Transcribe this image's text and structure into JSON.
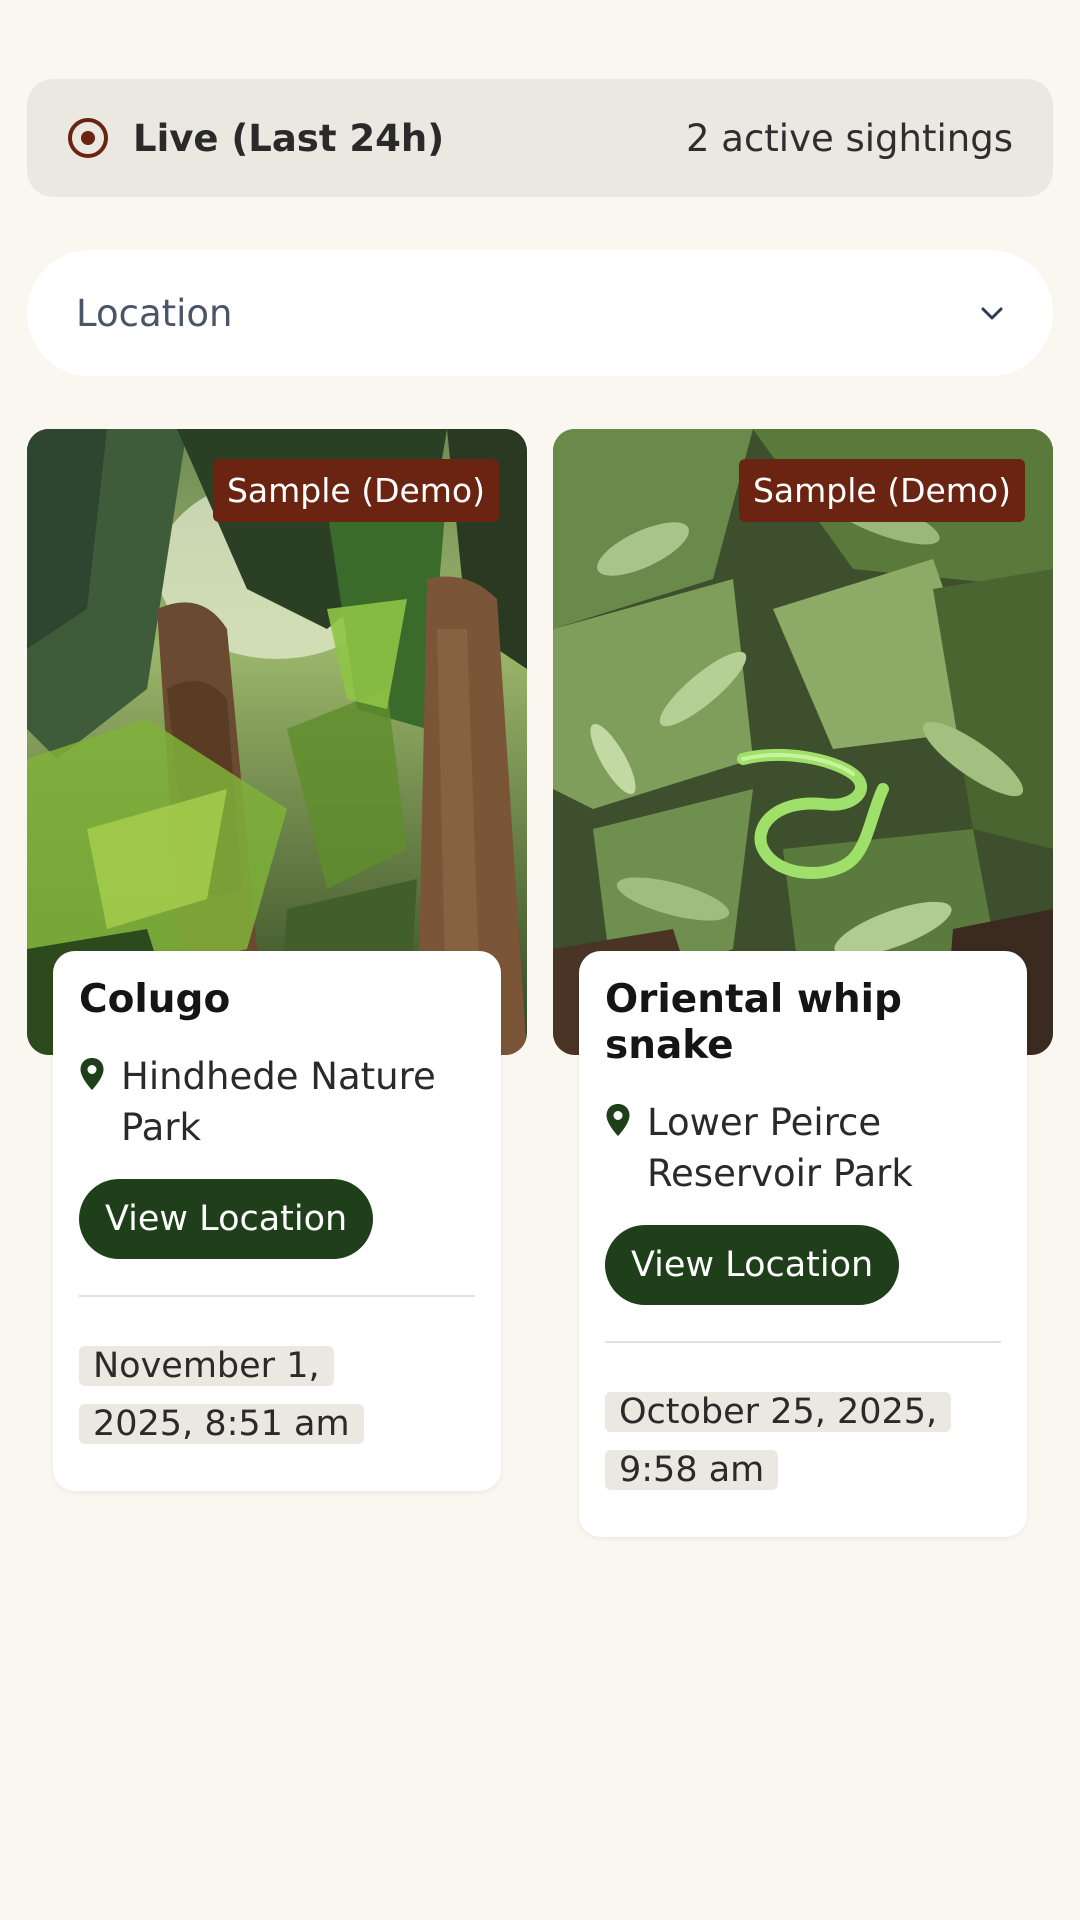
{
  "live": {
    "label": "Live (Last 24h)",
    "count": "2 active sightings",
    "icon": "target-icon",
    "accent": "#6b2412"
  },
  "filter": {
    "label": "Location",
    "icon": "chevron-down-icon"
  },
  "sightings": [
    {
      "badge": "Sample (Demo)",
      "species": "Colugo",
      "location": "Hindhede Nature Park",
      "button": "View Location",
      "time": "November 1, 2025, 8:51 am",
      "image": "forest-palm-trunk-photo"
    },
    {
      "badge": "Sample (Demo)",
      "species": "Oriental whip snake",
      "location": "Lower Peirce Reservoir Park",
      "button": "View Location",
      "time": "October 25, 2025, 9:58 am",
      "image": "green-snake-foliage-photo"
    }
  ],
  "colors": {
    "background": "#faf7f0",
    "button": "#1f3f1a",
    "badge": "#6b2412",
    "chip": "#ebe8e2"
  }
}
